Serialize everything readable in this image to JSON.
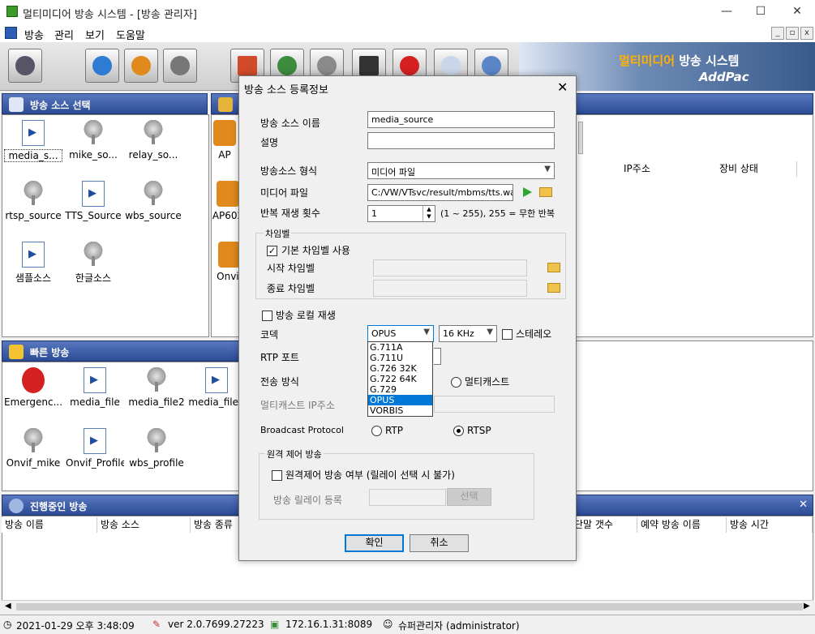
{
  "window": {
    "title": "멀티미디어 방송 시스템 - [방송 관리자]"
  },
  "menu": [
    "방송",
    "관리",
    "보기",
    "도움말"
  ],
  "brand": {
    "korean_highlight": "멀티미디어",
    "korean_rest": " 방송 시스템",
    "company": "AddPac"
  },
  "source_panel": {
    "title": "방송 소스 선택",
    "items": [
      "media_s...",
      "mike_so...",
      "relay_so...",
      "rtsp_source",
      "TTS_Source",
      "wbs_source",
      "샘플소스",
      "한글소스"
    ]
  },
  "device_panel": {
    "items": [
      "AP",
      "AP602",
      "Onvif"
    ],
    "columns": [
      "IP주소",
      "장비 상태"
    ]
  },
  "quick_panel": {
    "title": "빠른 방송",
    "items": [
      "Emergenc...",
      "media_file",
      "media_file2",
      "media_file3",
      "Onvif_mike",
      "Onvif_Profile",
      "wbs_profile"
    ]
  },
  "active_panel": {
    "title": "진행중인 방송",
    "columns": [
      "방송 이름",
      "방송 소스",
      "방송 종류",
      "단말 갯수",
      "예약 방송 이름",
      "방송 시간"
    ]
  },
  "dialog": {
    "title": "방송 소스 등록정보",
    "name_label": "방송 소스 이름",
    "name_value": "media_source",
    "desc_label": "설명",
    "desc_value": "",
    "type_label": "방송소스 형식",
    "type_value": "미디어 파일",
    "media_label": "미디어 파일",
    "media_value": "C:/VW/VTsvc/result/mbms/tts.wav",
    "repeat_label": "반복 재생 횟수",
    "repeat_value": "1",
    "repeat_hint": "(1 ~ 255), 255 = 무한 반복",
    "chime_group": "차임벨",
    "chime_default_label": "기본 차임벨 사용",
    "chime_default_checked": true,
    "chime_start_label": "시작 차임벨",
    "chime_end_label": "종료 차임벨",
    "local_play_label": "방송 로컬 재생",
    "codec_label": "코덱",
    "codec_value": "OPUS",
    "codec_options": [
      "G.711A",
      "G.711U",
      "G.726 32K",
      "G.722 64K",
      "G.729",
      "OPUS",
      "VORBIS"
    ],
    "codec_highlight": "OPUS",
    "rate_value": "16 KHz",
    "stereo_label": "스테레오",
    "rtp_port_label": "RTP 포트",
    "transport_label": "전송 방식",
    "multicast_label": "멀티캐스트",
    "multicast_ip_label": "멀티캐스트 IP주소",
    "protocol_label": "Broadcast Protocol",
    "protocol_rtp": "RTP",
    "protocol_rtsp": "RTSP",
    "protocol_selected": "RTSP",
    "remote_group": "원격 제어 방송",
    "remote_label": "원격제어 방송 여부 (릴레이 선택 시 불가)",
    "relay_label": "방송 릴레이 등록",
    "select_label": "선택",
    "ok_label": "확인",
    "cancel_label": "취소"
  },
  "status": {
    "datetime": "2021-01-29 오후 3:48:09",
    "version": "ver 2.0.7699.27223",
    "address": "172.16.1.31:8089",
    "user": "슈퍼관리자 (administrator)"
  },
  "colors": {
    "panel_header": "#2b4b95",
    "accent": "#0078d7",
    "brand_highlight": "#ffb000"
  }
}
